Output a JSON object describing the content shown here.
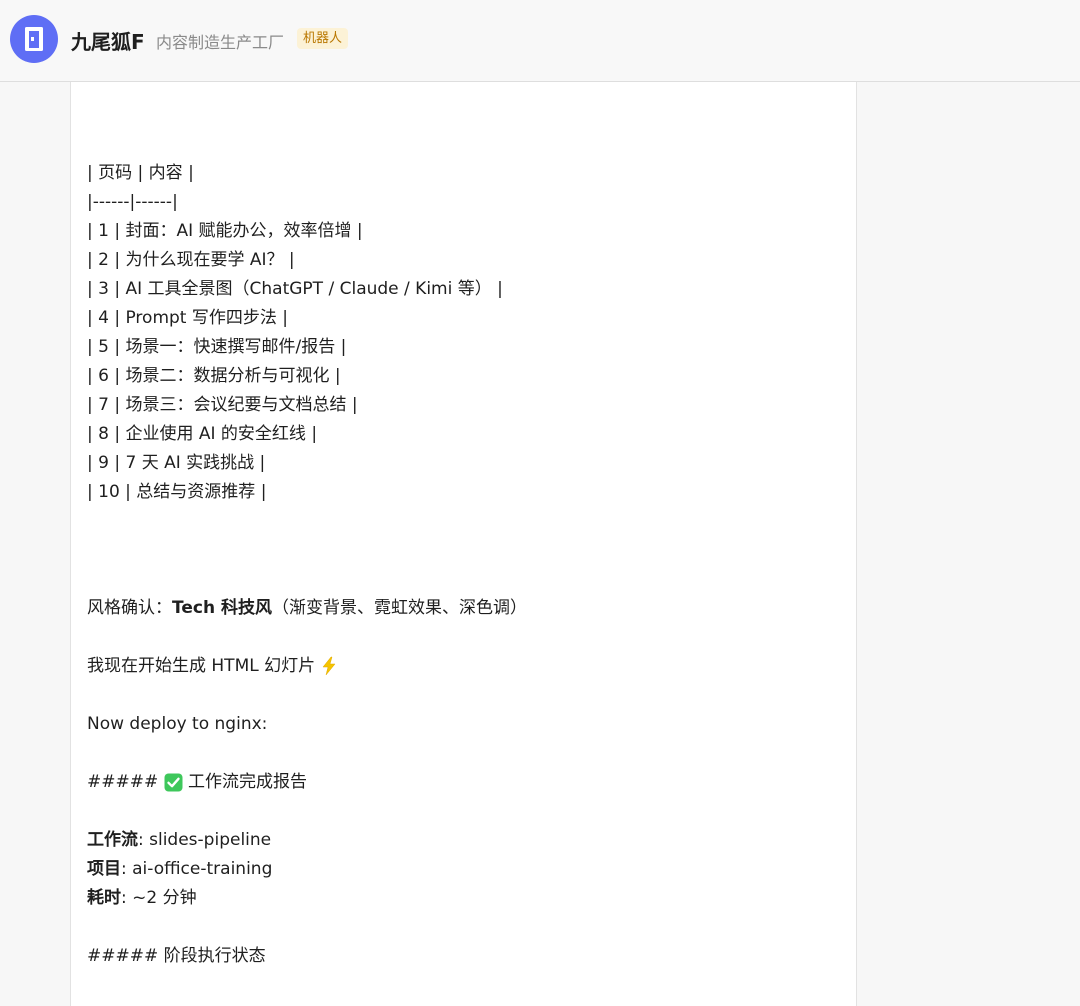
{
  "header": {
    "bot_name": "九尾狐F",
    "bot_subtitle": "内容制造生产工厂",
    "bot_tag": "机器人",
    "avatar_color": "#5f6ef5"
  },
  "message": {
    "table_lines": [
      "| 页码 | 内容 |",
      "|------|------|",
      "| 1 | 封面：AI 赋能办公，效率倍增 |",
      "| 2 | 为什么现在要学 AI？ |",
      "| 3 | AI 工具全景图（ChatGPT / Claude / Kimi 等） |",
      "| 4 | Prompt 写作四步法 |",
      "| 5 | 场景一：快速撰写邮件/报告 |",
      "| 6 | 场景二：数据分析与可视化 |",
      "| 7 | 场景三：会议纪要与文档总结 |",
      "| 8 | 企业使用 AI 的安全红线 |",
      "| 9 | 7 天 AI 实践挑战 |",
      "| 10 | 总结与资源推荐 |"
    ],
    "style_label": "风格确认：",
    "style_value": "Tech 科技风",
    "style_desc": "（渐变背景、霓虹效果、深色调）",
    "generating_text": "我现在开始生成 HTML 幻灯片",
    "generating_icon": "lightning-icon",
    "deploy_text": "Now deploy to nginx:",
    "report_heading_prefix": "#####",
    "report_heading_icon": "check-mark-icon",
    "report_heading_text": "工作流完成报告",
    "workflow_label": "工作流",
    "workflow_value": ": slides-pipeline",
    "project_label": "项目",
    "project_value": ": ai-office-training",
    "duration_label": "耗时",
    "duration_value": ": ~2 分钟",
    "stage_heading": "##### 阶段执行状态"
  }
}
